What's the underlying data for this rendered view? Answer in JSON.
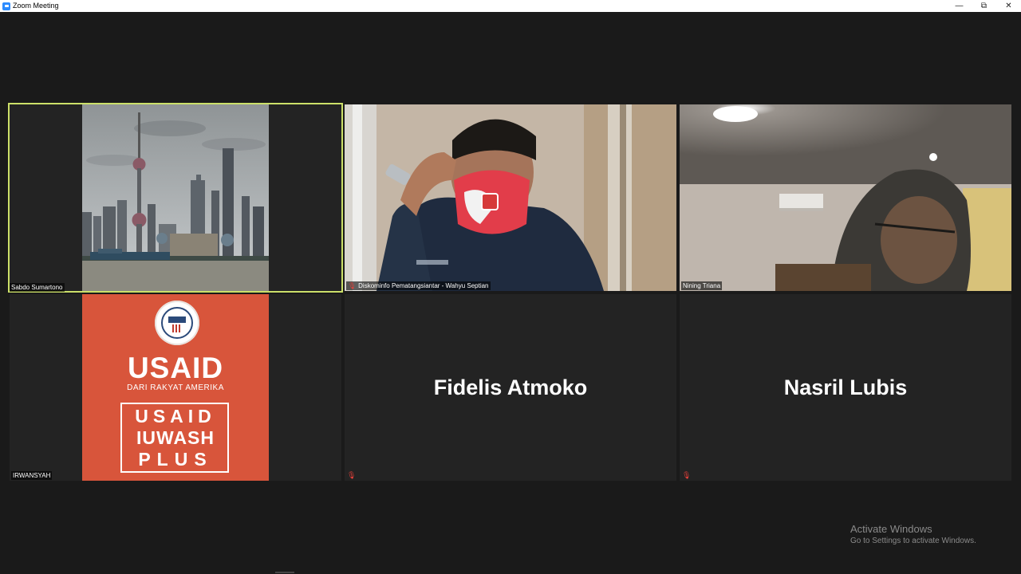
{
  "window": {
    "title": "Zoom Meeting"
  },
  "window_controls": {
    "minimize": "—",
    "restore": "⧉",
    "close": "✕"
  },
  "participants": [
    {
      "name": "Sabdo Sumartono"
    },
    {
      "name": "Diskominfo Pematangsiantar - Wahyu Septian",
      "muted": "true"
    },
    {
      "name": "Nining Triana"
    },
    {
      "name": "IRWANSYAH"
    },
    {
      "name": "Fidelis Atmoko",
      "muted": "true"
    },
    {
      "name": "Nasril Lubis",
      "muted": "true"
    }
  ],
  "usaid_card": {
    "logo_text": "USAID",
    "tagline": "DARI RAKYAT AMERIKA",
    "program_line1": "USAID",
    "program_line2": "IUWASH",
    "program_line3": "PLUS"
  },
  "watermark": {
    "line1": "Activate Windows",
    "line2": "Go to Settings to activate Windows."
  },
  "icons": {
    "mic_muted": "mic-muted-icon"
  },
  "colors": {
    "active_speaker": "#cce069",
    "usaid_orange": "#d8553b",
    "background": "#1a1a1a"
  }
}
